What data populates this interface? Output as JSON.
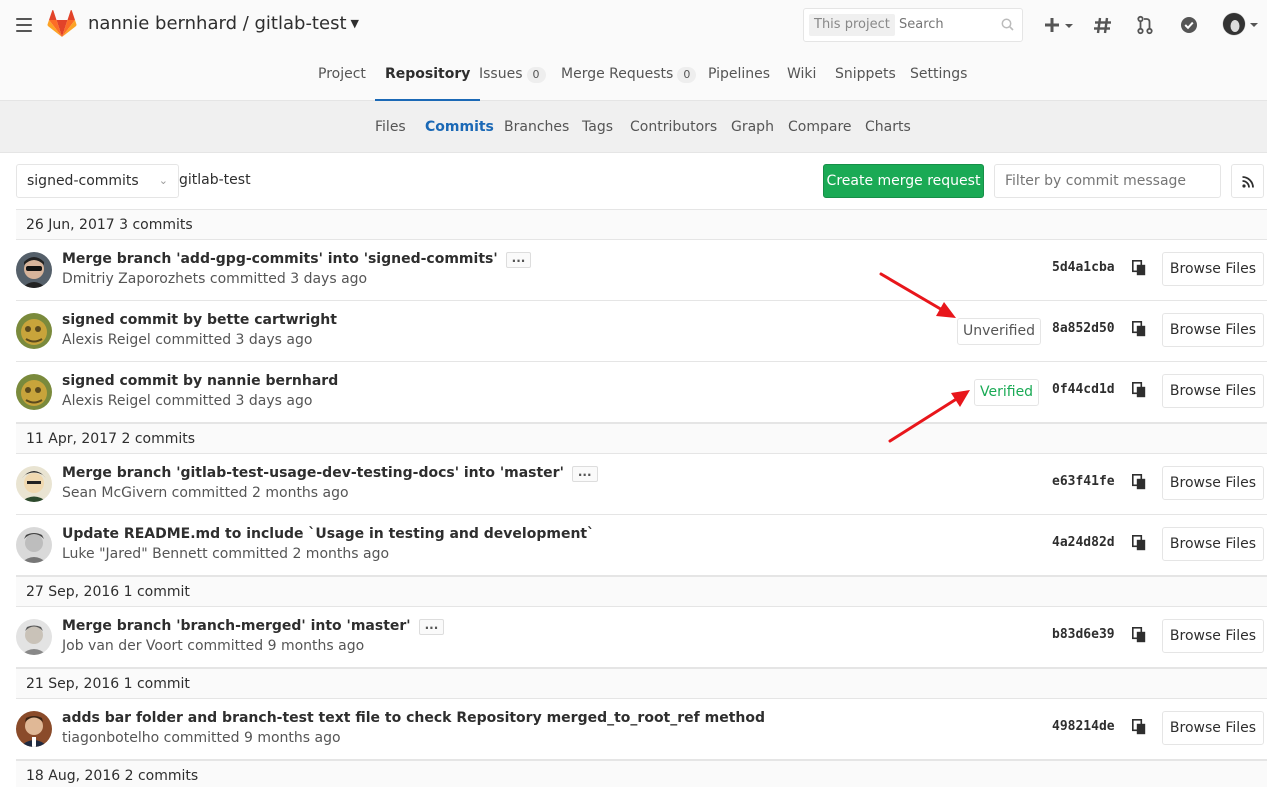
{
  "header": {
    "project_title": "nannie bernhard / gitlab-test",
    "search": {
      "scope": "This project",
      "placeholder": "Search"
    }
  },
  "nav": {
    "tabs": [
      {
        "label": "Project"
      },
      {
        "label": "Repository",
        "active": true
      },
      {
        "label": "Issues",
        "count": "0"
      },
      {
        "label": "Merge Requests",
        "count": "0"
      },
      {
        "label": "Pipelines"
      },
      {
        "label": "Wiki"
      },
      {
        "label": "Snippets"
      },
      {
        "label": "Settings"
      }
    ],
    "subtabs": [
      {
        "label": "Files"
      },
      {
        "label": "Commits",
        "active": true
      },
      {
        "label": "Branches"
      },
      {
        "label": "Tags"
      },
      {
        "label": "Contributors"
      },
      {
        "label": "Graph"
      },
      {
        "label": "Compare"
      },
      {
        "label": "Charts"
      }
    ]
  },
  "controls": {
    "branch": "signed-commits",
    "path": "gitlab-test",
    "create_mr_label": "Create merge request",
    "filter_placeholder": "Filter by commit message"
  },
  "browse_label": "Browse Files",
  "days": [
    {
      "header": "26 Jun, 2017 3 commits",
      "commits": [
        {
          "title": "Merge branch 'add-gpg-commits' into 'signed-commits'",
          "meta": "Dmitriy Zaporozhets committed 3 days ago",
          "sha": "5d4a1cba",
          "ellipsis": "...",
          "signature": ""
        },
        {
          "title": "signed commit by bette cartwright",
          "meta": "Alexis Reigel committed 3 days ago",
          "sha": "8a852d50",
          "signature": "Unverified"
        },
        {
          "title": "signed commit by nannie bernhard",
          "meta": "Alexis Reigel committed 3 days ago",
          "sha": "0f44cd1d",
          "signature": "Verified"
        }
      ]
    },
    {
      "header": "11 Apr, 2017 2 commits",
      "commits": [
        {
          "title": "Merge branch 'gitlab-test-usage-dev-testing-docs' into 'master'",
          "meta": "Sean McGivern committed 2 months ago",
          "sha": "e63f41fe",
          "ellipsis": "...",
          "signature": ""
        },
        {
          "title": "Update README.md to include `Usage in testing and development`",
          "meta": "Luke \"Jared\" Bennett committed 2 months ago",
          "sha": "4a24d82d",
          "signature": ""
        }
      ]
    },
    {
      "header": "27 Sep, 2016 1 commit",
      "commits": [
        {
          "title": "Merge branch 'branch-merged' into 'master'",
          "meta": "Job van der Voort committed 9 months ago",
          "sha": "b83d6e39",
          "ellipsis": "...",
          "signature": ""
        }
      ]
    },
    {
      "header": "21 Sep, 2016 1 commit",
      "commits": [
        {
          "title": "adds bar folder and branch-test text file to check Repository merged_to_root_ref method",
          "meta": "tiagonbotelho committed 9 months ago",
          "sha": "498214de",
          "signature": ""
        }
      ]
    },
    {
      "header": "18 Aug, 2016 2 commits",
      "commits": []
    }
  ],
  "colors": {
    "accent": "#1b69b6",
    "success": "#1aaa55",
    "annotation": "#e8161b"
  }
}
